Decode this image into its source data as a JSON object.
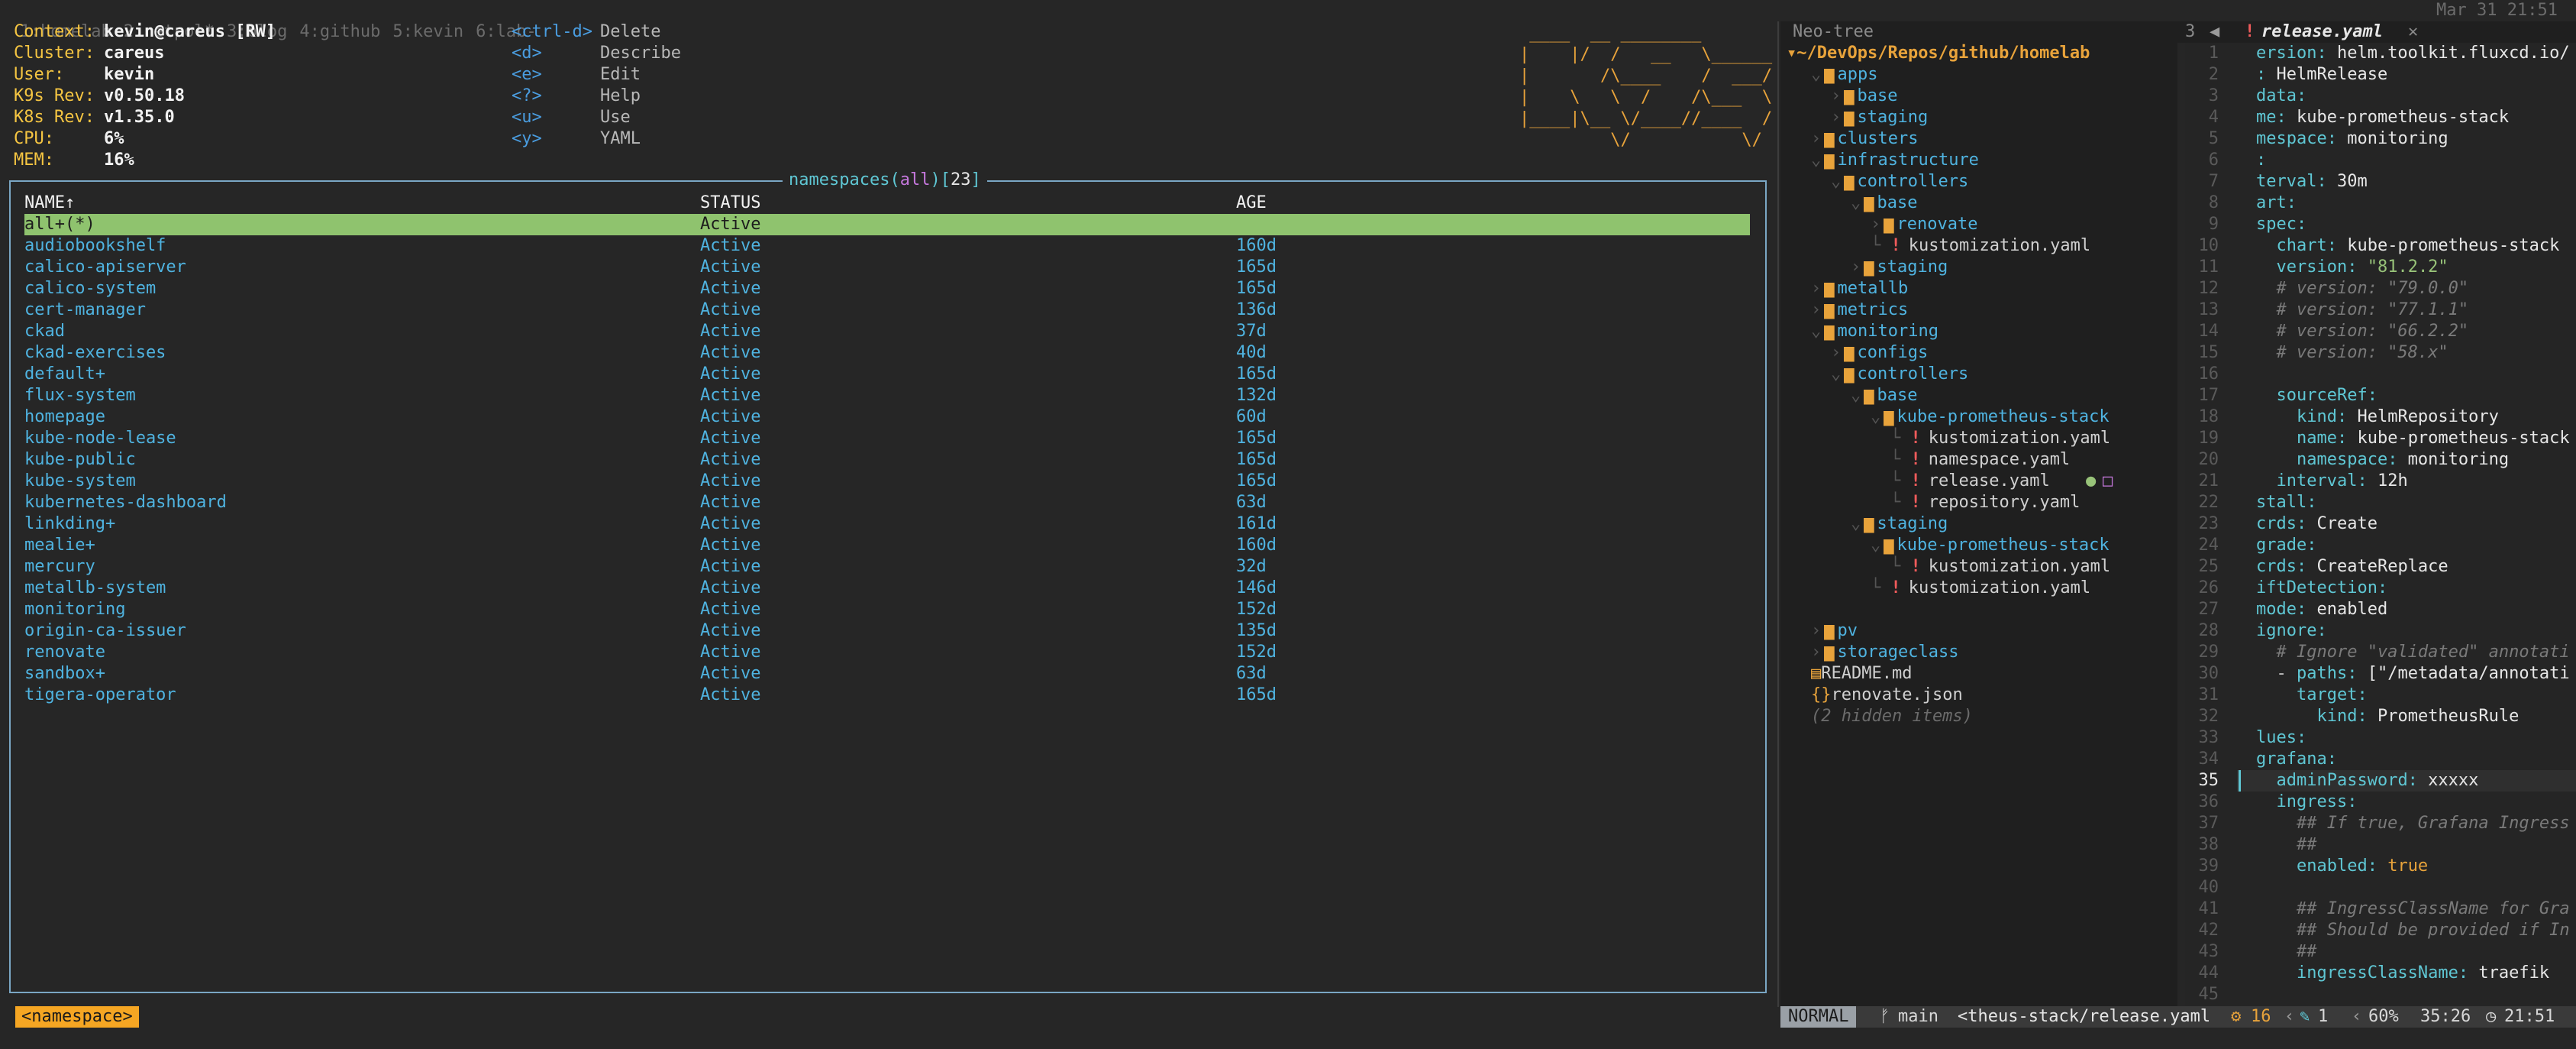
{
  "tmux": {
    "windows": [
      "1:homelab",
      "2:netpol*",
      "3:blog",
      "4:github",
      "5:kevin",
      "6:lab-"
    ],
    "clock": "Mar 31 21:51"
  },
  "k9s": {
    "info": [
      {
        "label": "Context:",
        "value": "kevin@careus [RW]"
      },
      {
        "label": "Cluster:",
        "value": "careus"
      },
      {
        "label": "User:",
        "value": "kevin"
      },
      {
        "label": "K9s Rev:",
        "value": "v0.50.18"
      },
      {
        "label": "K8s Rev:",
        "value": "v1.35.0"
      },
      {
        "label": "CPU:",
        "value": "6%"
      },
      {
        "label": "MEM:",
        "value": "16%"
      }
    ],
    "shortcuts": [
      {
        "key": "<ctrl-d>",
        "action": "Delete"
      },
      {
        "key": "<d>",
        "action": "Describe"
      },
      {
        "key": "<e>",
        "action": "Edit"
      },
      {
        "key": "<?>",
        "action": "Help"
      },
      {
        "key": "<u>",
        "action": "Use"
      },
      {
        "key": "<y>",
        "action": "YAML"
      }
    ],
    "logo": [
      " ____  __ ________       ",
      "|    |/  /   __   \\______",
      "|       /\\____    /  ___/",
      "|    \\   \\  /    /\\___  \\",
      "|____|\\__ \\/____//____  /",
      "         \\/           \\/ "
    ],
    "table": {
      "title_resource": "namespaces",
      "title_filter": "all",
      "title_count": "23",
      "columns": [
        "NAME↑",
        "STATUS",
        "AGE"
      ],
      "rows": [
        [
          "all+(*)",
          "Active",
          ""
        ],
        [
          "audiobookshelf",
          "Active",
          "160d"
        ],
        [
          "calico-apiserver",
          "Active",
          "165d"
        ],
        [
          "calico-system",
          "Active",
          "165d"
        ],
        [
          "cert-manager",
          "Active",
          "136d"
        ],
        [
          "ckad",
          "Active",
          "37d"
        ],
        [
          "ckad-exercises",
          "Active",
          "40d"
        ],
        [
          "default+",
          "Active",
          "165d"
        ],
        [
          "flux-system",
          "Active",
          "132d"
        ],
        [
          "homepage",
          "Active",
          "60d"
        ],
        [
          "kube-node-lease",
          "Active",
          "165d"
        ],
        [
          "kube-public",
          "Active",
          "165d"
        ],
        [
          "kube-system",
          "Active",
          "165d"
        ],
        [
          "kubernetes-dashboard",
          "Active",
          "63d"
        ],
        [
          "linkding+",
          "Active",
          "161d"
        ],
        [
          "mealie+",
          "Active",
          "160d"
        ],
        [
          "mercury",
          "Active",
          "32d"
        ],
        [
          "metallb-system",
          "Active",
          "146d"
        ],
        [
          "monitoring",
          "Active",
          "152d"
        ],
        [
          "origin-ca-issuer",
          "Active",
          "135d"
        ],
        [
          "renovate",
          "Active",
          "152d"
        ],
        [
          "sandbox+",
          "Active",
          "63d"
        ],
        [
          "tigera-operator",
          "Active",
          "165d"
        ]
      ]
    },
    "breadcrumb": "<namespace>"
  },
  "neotree": {
    "title": "Neo-tree",
    "root": "~/DevOps/Repos/github/homelab",
    "items": [
      {
        "indent": 1,
        "kind": "folder-open",
        "name": "apps"
      },
      {
        "indent": 2,
        "kind": "folder",
        "name": "base"
      },
      {
        "indent": 2,
        "kind": "folder",
        "name": "staging"
      },
      {
        "indent": 1,
        "kind": "folder",
        "name": "clusters"
      },
      {
        "indent": 1,
        "kind": "folder-open",
        "name": "infrastructure"
      },
      {
        "indent": 2,
        "kind": "folder-open",
        "name": "controllers"
      },
      {
        "indent": 3,
        "kind": "folder-open",
        "name": "base"
      },
      {
        "indent": 4,
        "kind": "folder",
        "name": "renovate"
      },
      {
        "indent": 4,
        "kind": "file-excl",
        "name": "kustomization.yaml"
      },
      {
        "indent": 3,
        "kind": "folder",
        "name": "staging"
      },
      {
        "indent": 1,
        "kind": "folder",
        "name": "metallb"
      },
      {
        "indent": 1,
        "kind": "folder",
        "name": "metrics"
      },
      {
        "indent": 1,
        "kind": "folder-open",
        "name": "monitoring"
      },
      {
        "indent": 2,
        "kind": "folder",
        "name": "configs"
      },
      {
        "indent": 2,
        "kind": "folder-open",
        "name": "controllers"
      },
      {
        "indent": 3,
        "kind": "folder-open",
        "name": "base"
      },
      {
        "indent": 4,
        "kind": "folder-open",
        "name": "kube-prometheus-stack"
      },
      {
        "indent": 5,
        "kind": "file-excl",
        "name": "kustomization.yaml"
      },
      {
        "indent": 5,
        "kind": "file-excl",
        "name": "namespace.yaml"
      },
      {
        "indent": 5,
        "kind": "file-excl",
        "name": "release.yaml",
        "selected": true
      },
      {
        "indent": 5,
        "kind": "file-excl",
        "name": "repository.yaml"
      },
      {
        "indent": 3,
        "kind": "folder-open",
        "name": "staging"
      },
      {
        "indent": 4,
        "kind": "folder-open",
        "name": "kube-prometheus-stack"
      },
      {
        "indent": 5,
        "kind": "file-excl",
        "name": "kustomization.yaml"
      },
      {
        "indent": 4,
        "kind": "file-excl",
        "name": "kustomization.yaml"
      },
      {
        "indent": 0,
        "kind": "blank",
        "name": ""
      },
      {
        "indent": 1,
        "kind": "folder",
        "name": "pv"
      },
      {
        "indent": 1,
        "kind": "folder",
        "name": "storageclass"
      },
      {
        "indent": 1,
        "kind": "file-md",
        "name": "README.md"
      },
      {
        "indent": 1,
        "kind": "file-json",
        "name": "renovate.json"
      },
      {
        "indent": 1,
        "kind": "hidden",
        "name": "(2 hidden items)"
      }
    ]
  },
  "editor": {
    "tab_number": "3",
    "tab_name": "release.yaml",
    "current_line": 35,
    "lines": [
      {
        "n": "1",
        "t": "ersion: helm.toolkit.fluxcd.io/"
      },
      {
        "n": "2",
        "t": ": HelmRelease"
      },
      {
        "n": "3",
        "t": "data:"
      },
      {
        "n": "4",
        "t": "me: kube-prometheus-stack"
      },
      {
        "n": "5",
        "t": "mespace: monitoring"
      },
      {
        "n": "6",
        "t": ":"
      },
      {
        "n": "7",
        "t": "terval: 30m"
      },
      {
        "n": "8",
        "t": "art:"
      },
      {
        "n": "9",
        "t": "spec:"
      },
      {
        "n": "10",
        "t": "  chart: kube-prometheus-stack"
      },
      {
        "n": "11",
        "t": "  version: \"81.2.2\""
      },
      {
        "n": "12",
        "t": "  # version: \"79.0.0\""
      },
      {
        "n": "13",
        "t": "  # version: \"77.1.1\""
      },
      {
        "n": "14",
        "t": "  # version: \"66.2.2\""
      },
      {
        "n": "15",
        "t": "  # version: \"58.x\""
      },
      {
        "n": "16",
        "t": ""
      },
      {
        "n": "17",
        "t": "  sourceRef:"
      },
      {
        "n": "18",
        "t": "    kind: HelmRepository"
      },
      {
        "n": "19",
        "t": "    name: kube-prometheus-stack"
      },
      {
        "n": "20",
        "t": "    namespace: monitoring"
      },
      {
        "n": "21",
        "t": "  interval: 12h"
      },
      {
        "n": "22",
        "t": "stall:"
      },
      {
        "n": "23",
        "t": "crds: Create"
      },
      {
        "n": "24",
        "t": "grade:"
      },
      {
        "n": "25",
        "t": "crds: CreateReplace"
      },
      {
        "n": "26",
        "t": "iftDetection:"
      },
      {
        "n": "27",
        "t": "mode: enabled"
      },
      {
        "n": "28",
        "t": "ignore:"
      },
      {
        "n": "29",
        "t": "  # Ignore \"validated\" annotati"
      },
      {
        "n": "30",
        "t": "  - paths: [\"/metadata/annotati"
      },
      {
        "n": "31",
        "t": "    target:"
      },
      {
        "n": "32",
        "t": "      kind: PrometheusRule"
      },
      {
        "n": "33",
        "t": "lues:"
      },
      {
        "n": "34",
        "t": "grafana:"
      },
      {
        "n": "35",
        "t": "  adminPassword: xxxxx"
      },
      {
        "n": "36",
        "t": "  ingress:"
      },
      {
        "n": "37",
        "t": "    ## If true, Grafana Ingress"
      },
      {
        "n": "38",
        "t": "    ##"
      },
      {
        "n": "39",
        "t": "    enabled: true"
      },
      {
        "n": "40",
        "t": ""
      },
      {
        "n": "41",
        "t": "    ## IngressClassName for Gra"
      },
      {
        "n": "42",
        "t": "    ## Should be provided if In"
      },
      {
        "n": "43",
        "t": "    ##"
      },
      {
        "n": "44",
        "t": "    ingressClassName: traefik"
      },
      {
        "n": "45",
        "t": ""
      }
    ]
  },
  "statusline": {
    "mode": "NORMAL",
    "branch": "main",
    "file": "<theus-stack/release.yaml",
    "diag_count": "16",
    "edit_count": "1",
    "percent": "60%",
    "position": "35:26",
    "time": "21:51"
  },
  "colors": {
    "background": "#262626",
    "k9s_yellow": "#f5c542",
    "k9s_logo_orange": "#e8a33b",
    "row_blue": "#4fb3e0",
    "selected_row": "#8fc36e",
    "border": "#7aa6c4",
    "breadcrumb_bg": "#f5a623"
  }
}
